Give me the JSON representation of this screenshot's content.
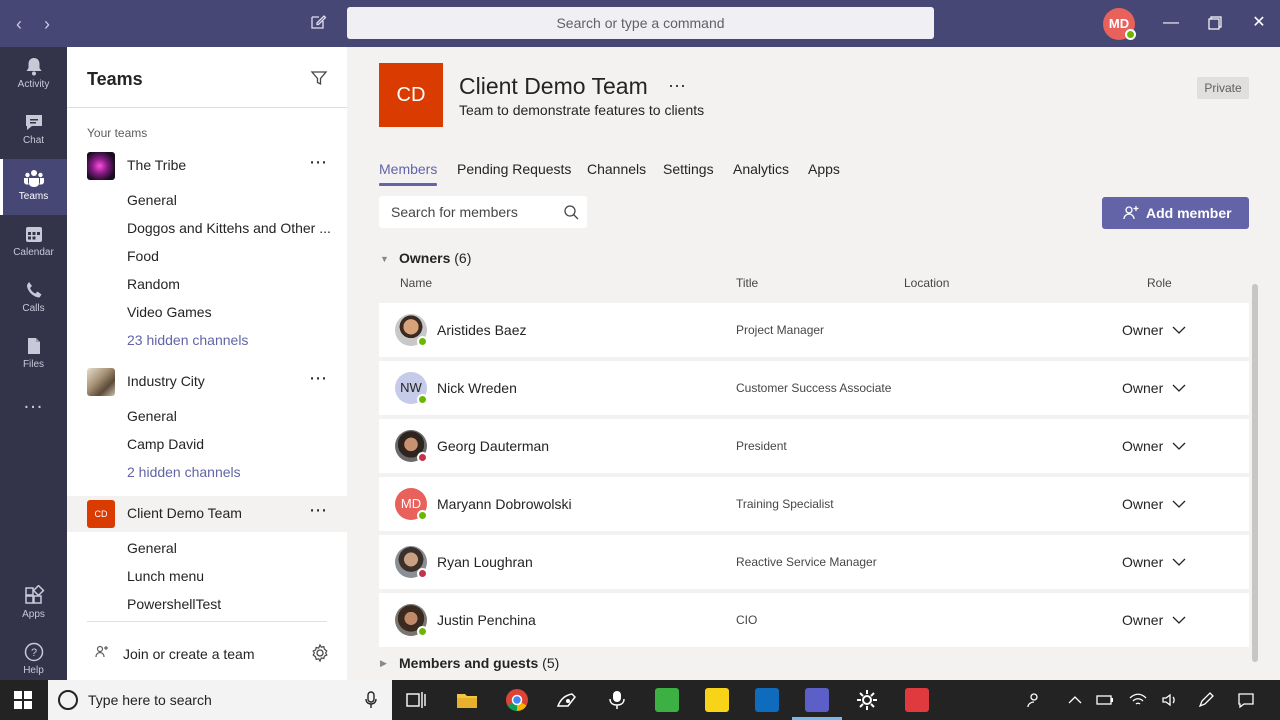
{
  "titlebar": {
    "search_placeholder": "Search or type a command",
    "user_initials": "MD"
  },
  "rail": {
    "items": [
      {
        "label": "Activity",
        "icon": "bell-icon"
      },
      {
        "label": "Chat",
        "icon": "chat-icon"
      },
      {
        "label": "Teams",
        "icon": "teams-icon"
      },
      {
        "label": "Calendar",
        "icon": "calendar-icon"
      },
      {
        "label": "Calls",
        "icon": "phone-icon"
      },
      {
        "label": "Files",
        "icon": "files-icon"
      },
      {
        "label": "...",
        "icon": "more-icon"
      },
      {
        "label": "Apps",
        "icon": "apps-icon"
      },
      {
        "label": "Help",
        "icon": "help-icon"
      }
    ]
  },
  "teams_panel": {
    "title": "Teams",
    "section_label": "Your teams",
    "teams": [
      {
        "name": "The Tribe",
        "channels": [
          "General",
          "Doggos and Kittehs and Other ...",
          "Food",
          "Random",
          "Video Games"
        ],
        "hidden": "23 hidden channels"
      },
      {
        "name": "Industry City",
        "channels": [
          "General",
          "Camp David"
        ],
        "hidden": "2 hidden channels"
      },
      {
        "name": "Client Demo Team",
        "initials": "CD",
        "channels": [
          "General",
          "Lunch menu",
          "PowershellTest"
        ]
      }
    ],
    "join_label": "Join or create a team"
  },
  "main": {
    "team_initials": "CD",
    "team_title": "Client Demo Team",
    "team_ellipsis": "···",
    "team_description": "Team to demonstrate features to clients",
    "privacy": "Private",
    "tabs": [
      "Members",
      "Pending Requests",
      "Channels",
      "Settings",
      "Analytics",
      "Apps"
    ],
    "member_search_placeholder": "Search for members",
    "add_member_label": "Add member",
    "owners_label": "Owners",
    "owners_count": "(6)",
    "columns": {
      "name": "Name",
      "title": "Title",
      "location": "Location",
      "role": "Role"
    },
    "members": [
      {
        "name": "Aristides Baez",
        "title": "Project Manager",
        "role": "Owner",
        "presence": "available"
      },
      {
        "name": "Nick Wreden",
        "initials": "NW",
        "title": "Customer Success Associate",
        "role": "Owner",
        "presence": "available"
      },
      {
        "name": "Georg Dauterman",
        "title": "President",
        "role": "Owner",
        "presence": "busy"
      },
      {
        "name": "Maryann Dobrowolski",
        "initials": "MD",
        "title": "Training Specialist",
        "role": "Owner",
        "presence": "available"
      },
      {
        "name": "Ryan Loughran",
        "title": "Reactive Service Manager",
        "role": "Owner",
        "presence": "busy"
      },
      {
        "name": "Justin Penchina",
        "title": "CIO",
        "role": "Owner",
        "presence": "available"
      }
    ],
    "guests_label": "Members and guests",
    "guests_count": "(5)"
  },
  "taskbar": {
    "search_placeholder": "Type here to search"
  },
  "colors": {
    "accent": "#6264a7",
    "titlebar": "#464775",
    "rail": "#33344a",
    "team_logo": "#da3b01",
    "presence_available": "#6bb700",
    "presence_busy": "#c4314b"
  }
}
